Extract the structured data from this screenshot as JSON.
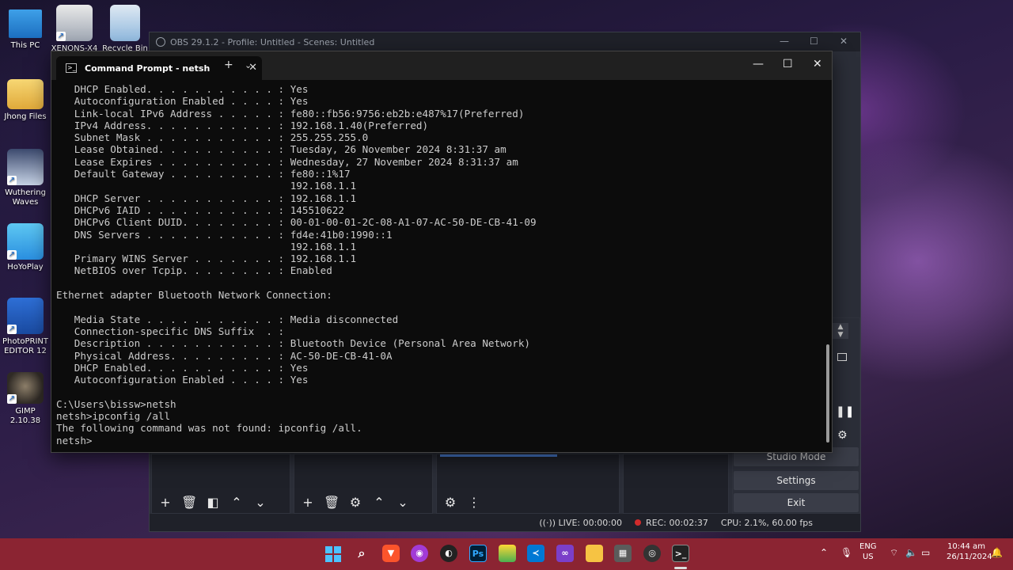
{
  "desktop": {
    "icons": [
      {
        "label": "This PC"
      },
      {
        "label": "XENONS-X4"
      },
      {
        "label": "Recycle Bin"
      },
      {
        "label": "Jhong Files"
      },
      {
        "label": "Wuthering Waves"
      },
      {
        "label": "HoYoPlay"
      },
      {
        "label": "PhotoPRINT EDITOR 12"
      },
      {
        "label": "GIMP 2.10.38"
      }
    ]
  },
  "obs": {
    "title": "OBS 29.1.2 - Profile: Untitled - Scenes: Untitled",
    "controls": {
      "studio_mode": "Studio Mode",
      "settings": "Settings",
      "exit": "Exit"
    },
    "status": {
      "live": "LIVE: 00:00:00",
      "rec": "REC: 00:02:37",
      "cpu": "CPU: 2.1%, 60.00 fps"
    }
  },
  "terminal": {
    "tab_title": "Command Prompt - netsh",
    "lines": [
      "   DHCP Enabled. . . . . . . . . . . : Yes",
      "   Autoconfiguration Enabled . . . . : Yes",
      "   Link-local IPv6 Address . . . . . : fe80::fb56:9756:eb2b:e487%17(Preferred)",
      "   IPv4 Address. . . . . . . . . . . : 192.168.1.40(Preferred)",
      "   Subnet Mask . . . . . . . . . . . : 255.255.255.0",
      "   Lease Obtained. . . . . . . . . . : Tuesday, 26 November 2024 8:31:37 am",
      "   Lease Expires . . . . . . . . . . : Wednesday, 27 November 2024 8:31:37 am",
      "   Default Gateway . . . . . . . . . : fe80::1%17",
      "                                       192.168.1.1",
      "   DHCP Server . . . . . . . . . . . : 192.168.1.1",
      "   DHCPv6 IAID . . . . . . . . . . . : 145510622",
      "   DHCPv6 Client DUID. . . . . . . . : 00-01-00-01-2C-08-A1-07-AC-50-DE-CB-41-09",
      "   DNS Servers . . . . . . . . . . . : fd4e:41b0:1990::1",
      "                                       192.168.1.1",
      "   Primary WINS Server . . . . . . . : 192.168.1.1",
      "   NetBIOS over Tcpip. . . . . . . . : Enabled",
      "",
      "Ethernet adapter Bluetooth Network Connection:",
      "",
      "   Media State . . . . . . . . . . . : Media disconnected",
      "   Connection-specific DNS Suffix  . :",
      "   Description . . . . . . . . . . . : Bluetooth Device (Personal Area Network)",
      "   Physical Address. . . . . . . . . : AC-50-DE-CB-41-0A",
      "   DHCP Enabled. . . . . . . . . . . : Yes",
      "   Autoconfiguration Enabled . . . . : Yes",
      "",
      "C:\\Users\\bissw>netsh",
      "netsh>ipconfig /all",
      "The following command was not found: ipconfig /all.",
      "netsh>"
    ]
  },
  "taskbar": {
    "apps": [
      {
        "icon": "windows-start-icon"
      },
      {
        "icon": "search-icon"
      },
      {
        "icon": "brave-browser-icon"
      },
      {
        "icon": "app-purple-icon"
      },
      {
        "icon": "github-icon"
      },
      {
        "icon": "photoshop-icon",
        "text": "Ps"
      },
      {
        "icon": "paint-icon"
      },
      {
        "icon": "vscode-icon"
      },
      {
        "icon": "visual-studio-icon"
      },
      {
        "icon": "file-explorer-icon"
      },
      {
        "icon": "calculator-icon"
      },
      {
        "icon": "obs-icon"
      },
      {
        "icon": "terminal-icon"
      }
    ],
    "lang_primary": "ENG",
    "lang_secondary": "US",
    "time": "10:44 am",
    "date": "26/11/2024"
  },
  "colors": {
    "taskbar": "#8b2432",
    "terminal_bg": "#0c0c0c",
    "terminal_text": "#cccccc",
    "obs_bg": "#2b2e38"
  }
}
